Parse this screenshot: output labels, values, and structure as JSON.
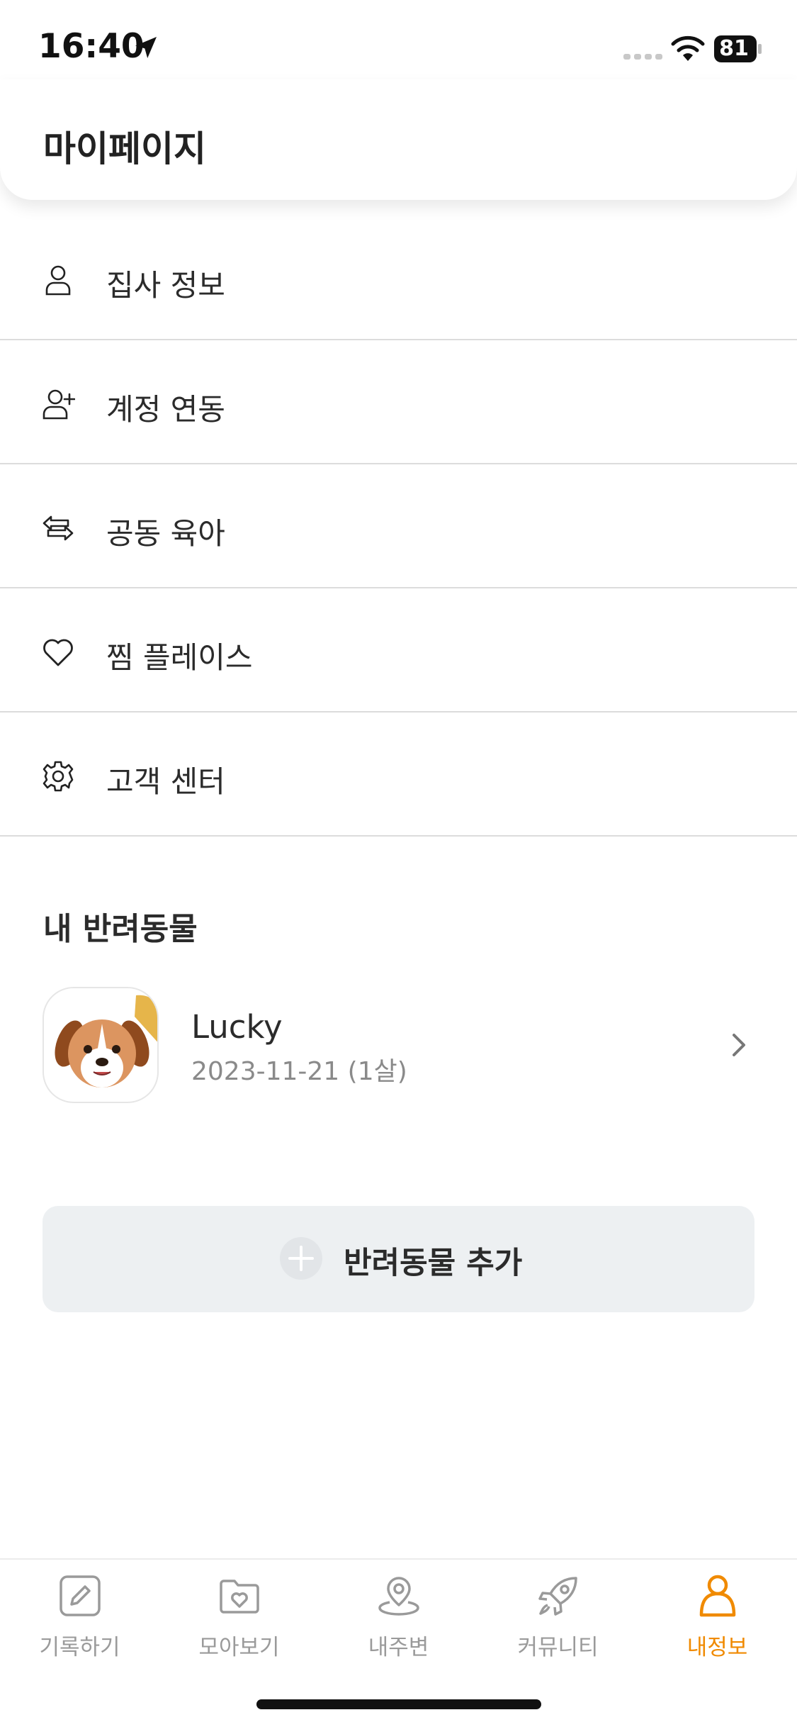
{
  "status_bar": {
    "time": "16:40",
    "battery": "81",
    "location_icon": "location-arrow-icon",
    "wifi_icon": "wifi-icon"
  },
  "header": {
    "title": "마이페이지"
  },
  "menu": {
    "items": [
      {
        "label": "집사 정보",
        "icon": "user-icon"
      },
      {
        "label": "계정 연동",
        "icon": "user-plus-icon"
      },
      {
        "label": "공동 육아",
        "icon": "swap-arrows-icon"
      },
      {
        "label": "찜 플레이스",
        "icon": "heart-icon"
      },
      {
        "label": "고객 센터",
        "icon": "gear-icon"
      }
    ]
  },
  "pets": {
    "section_title": "내 반려동물",
    "list": [
      {
        "name": "Lucky",
        "birth": "2023-11-21 (1살)",
        "avatar": "dog-avatar"
      }
    ],
    "add_label": "반려동물 추가"
  },
  "tab_bar": {
    "active_color": "#f08a00",
    "inactive_color": "#9a9a9a",
    "tabs": [
      {
        "label": "기록하기",
        "icon": "pencil-icon"
      },
      {
        "label": "모아보기",
        "icon": "folder-heart-icon"
      },
      {
        "label": "내주변",
        "icon": "map-pin-icon"
      },
      {
        "label": "커뮤니티",
        "icon": "rocket-icon"
      },
      {
        "label": "내정보",
        "icon": "person-icon",
        "active": true
      }
    ]
  }
}
